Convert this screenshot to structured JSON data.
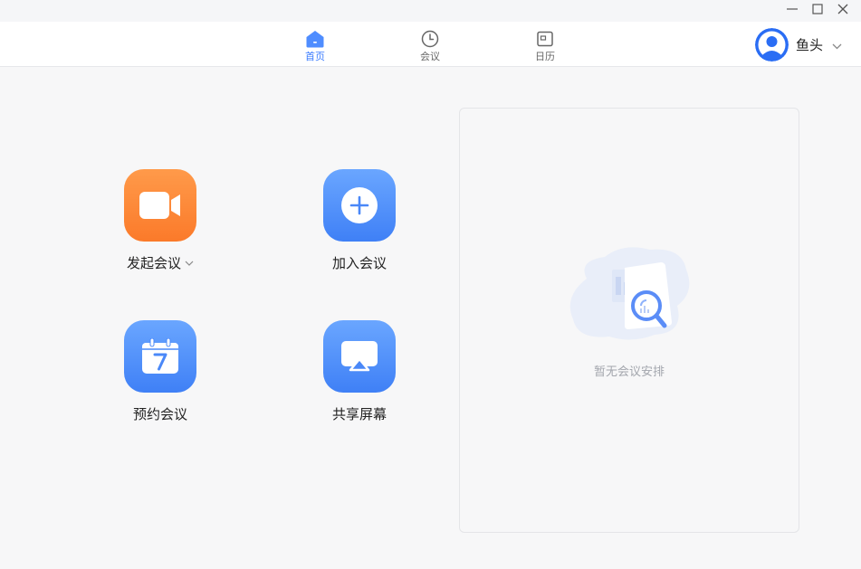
{
  "window": {
    "controls": [
      "minimize-icon",
      "maximize-icon",
      "close-icon"
    ]
  },
  "nav": {
    "tabs": [
      {
        "label": "首页",
        "icon": "home-icon",
        "active": true
      },
      {
        "label": "会议",
        "icon": "clock-icon",
        "active": false
      },
      {
        "label": "日历",
        "icon": "calendar-icon",
        "active": false
      }
    ]
  },
  "user": {
    "name": "鱼头",
    "avatar_icon": "user-avatar-icon"
  },
  "actions": [
    {
      "label": "发起会议",
      "icon": "video-camera-icon",
      "color": "#fb7a2a",
      "has_dropdown": true
    },
    {
      "label": "加入会议",
      "icon": "plus-circle-icon",
      "color": "#3f80f6"
    },
    {
      "label": "预约会议",
      "icon": "calendar-7-icon",
      "color": "#3f80f6"
    },
    {
      "label": "共享屏幕",
      "icon": "screen-share-icon",
      "color": "#3f80f6"
    }
  ],
  "schedule_panel": {
    "empty_text": "暂无会议安排",
    "empty_icon": "search-document-icon"
  },
  "colors": {
    "accent": "#3b7cff",
    "orange": "#fb7a2a"
  }
}
